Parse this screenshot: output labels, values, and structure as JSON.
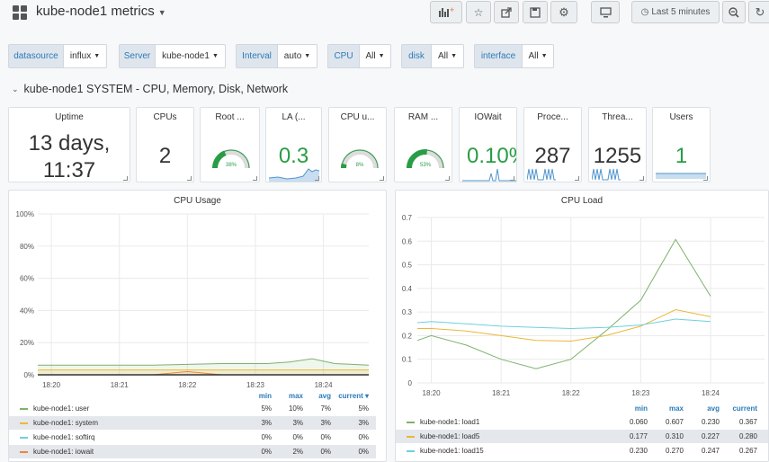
{
  "header": {
    "title": "kube-node1 metrics",
    "time_range": "Last 5 minutes"
  },
  "variables": [
    {
      "label": "datasource",
      "value": "influx"
    },
    {
      "label": "Server",
      "value": "kube-node1"
    },
    {
      "label": "Interval",
      "value": "auto"
    },
    {
      "label": "CPU",
      "value": "All"
    },
    {
      "label": "disk",
      "value": "All"
    },
    {
      "label": "interface",
      "value": "All"
    }
  ],
  "row": {
    "title": "kube-node1 SYSTEM - CPU, Memory, Disk, Network"
  },
  "stats": {
    "uptime": {
      "title": "Uptime",
      "line1": "13 days,",
      "line2": "11:37"
    },
    "cpus": {
      "title": "CPUs",
      "value": "2"
    },
    "root": {
      "title": "Root ...",
      "gauge": "38%",
      "level": 0.38
    },
    "la": {
      "title": "LA (...",
      "value": "0.3"
    },
    "cpu_u": {
      "title": "CPU u...",
      "gauge": "8%",
      "level": 0.08
    },
    "ram": {
      "title": "RAM ...",
      "gauge": "53%",
      "level": 0.53
    },
    "iowait": {
      "title": "IOWait",
      "value": "0.10%"
    },
    "proce": {
      "title": "Proce...",
      "value": "287"
    },
    "threa": {
      "title": "Threa...",
      "value": "1255"
    },
    "users": {
      "title": "Users",
      "value": "1"
    }
  },
  "colors": {
    "green": "#299c46",
    "value_dark": "#333333",
    "sparkline": "#5195ce",
    "accent": "#2b7bb9"
  },
  "cpu_usage": {
    "title": "CPU Usage",
    "legend_headers": {
      "min": "min",
      "max": "max",
      "avg": "avg",
      "current": "current ▾"
    },
    "legend": [
      {
        "name": "kube-node1: user",
        "color": "#7eb26d",
        "min": "5%",
        "max": "10%",
        "avg": "7%",
        "current": "5%"
      },
      {
        "name": "kube-node1: system",
        "color": "#eab839",
        "min": "3%",
        "max": "3%",
        "avg": "3%",
        "current": "3%"
      },
      {
        "name": "kube-node1: softirq",
        "color": "#6ed0e0",
        "min": "0%",
        "max": "0%",
        "avg": "0%",
        "current": "0%"
      },
      {
        "name": "kube-node1: iowait",
        "color": "#ef843c",
        "min": "0%",
        "max": "2%",
        "avg": "0%",
        "current": "0%"
      }
    ]
  },
  "cpu_load": {
    "title": "CPU Load",
    "legend_headers": {
      "min": "min",
      "max": "max",
      "avg": "avg",
      "current": "current"
    },
    "legend": [
      {
        "name": "kube-node1: load1",
        "color": "#7eb26d",
        "min": "0.060",
        "max": "0.607",
        "avg": "0.230",
        "current": "0.367"
      },
      {
        "name": "kube-node1: load5",
        "color": "#eab839",
        "min": "0.177",
        "max": "0.310",
        "avg": "0.227",
        "current": "0.280"
      },
      {
        "name": "kube-node1: load15",
        "color": "#6ed0e0",
        "min": "0.230",
        "max": "0.270",
        "avg": "0.247",
        "current": "0.267"
      }
    ]
  },
  "chart_data": [
    {
      "type": "area",
      "title": "CPU Usage",
      "x": [
        "18:20",
        "18:21",
        "18:22",
        "18:23",
        "18:24"
      ],
      "ylim": [
        0,
        100
      ],
      "yticks": [
        "0%",
        "20%",
        "40%",
        "60%",
        "80%",
        "100%"
      ],
      "xticks": [
        "18:20",
        "18:21",
        "18:22",
        "18:23",
        "18:24"
      ],
      "series": [
        {
          "name": "kube-node1: user",
          "x": [
            "18:19:48",
            "18:20:30",
            "18:21:30",
            "18:22:30",
            "18:23:10",
            "18:23:30",
            "18:23:50",
            "18:24:10",
            "18:24:40"
          ],
          "values": [
            6,
            6,
            6,
            7,
            7,
            8,
            10,
            7,
            6
          ]
        },
        {
          "name": "kube-node1: system",
          "x": [
            "18:19:48",
            "18:20:30",
            "18:21:30",
            "18:22:30",
            "18:23:30",
            "18:24:40"
          ],
          "values": [
            3,
            3,
            3,
            3,
            3,
            3
          ]
        },
        {
          "name": "kube-node1: softirq",
          "x": [
            "18:19:48",
            "18:24:40"
          ],
          "values": [
            0,
            0
          ]
        },
        {
          "name": "kube-node1: iowait",
          "x": [
            "18:19:48",
            "18:21:30",
            "18:22:00",
            "18:22:30",
            "18:24:40"
          ],
          "values": [
            0,
            0,
            2,
            0,
            0
          ]
        }
      ]
    },
    {
      "type": "line",
      "title": "CPU Load",
      "x": [
        "18:19:48",
        "18:20:00",
        "18:20:30",
        "18:21:00",
        "18:21:30",
        "18:22:00",
        "18:22:30",
        "18:23:00",
        "18:23:30",
        "18:24:00"
      ],
      "ylim": [
        0,
        0.7
      ],
      "yticks": [
        "0",
        "0.1",
        "0.2",
        "0.3",
        "0.4",
        "0.5",
        "0.6",
        "0.7"
      ],
      "xticks": [
        "18:20",
        "18:21",
        "18:22",
        "18:23",
        "18:24"
      ],
      "series": [
        {
          "name": "kube-node1: load1",
          "values": [
            0.18,
            0.2,
            0.16,
            0.1,
            0.06,
            0.1,
            0.22,
            0.35,
            0.607,
            0.367
          ]
        },
        {
          "name": "kube-node1: load5",
          "values": [
            0.23,
            0.23,
            0.22,
            0.2,
            0.18,
            0.177,
            0.2,
            0.24,
            0.31,
            0.28
          ]
        },
        {
          "name": "kube-node1: load15",
          "values": [
            0.255,
            0.26,
            0.25,
            0.24,
            0.235,
            0.23,
            0.235,
            0.245,
            0.27,
            0.26
          ]
        }
      ]
    }
  ]
}
